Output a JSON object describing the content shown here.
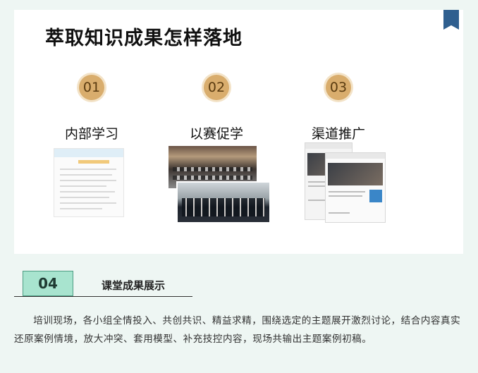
{
  "slide": {
    "title": "萃取知识成果怎样落地",
    "steps": [
      {
        "number": "01",
        "label": "内部学习"
      },
      {
        "number": "02",
        "label": "以赛促学"
      },
      {
        "number": "03",
        "label": "渠道推广"
      }
    ]
  },
  "section": {
    "number": "04",
    "title": "课堂成果展示"
  },
  "paragraph": "培训现场，各小组全情投入、共创共识、精益求精，围绕选定的主题展开激烈讨论，结合内容真实还原案例情境，放大冲突、套用模型、补充技控内容，现场共输出主题案例初稿。",
  "colors": {
    "badge": "#d9ad6d",
    "section_box": "#a8e4cf",
    "bookmark": "#2f5f8f"
  }
}
